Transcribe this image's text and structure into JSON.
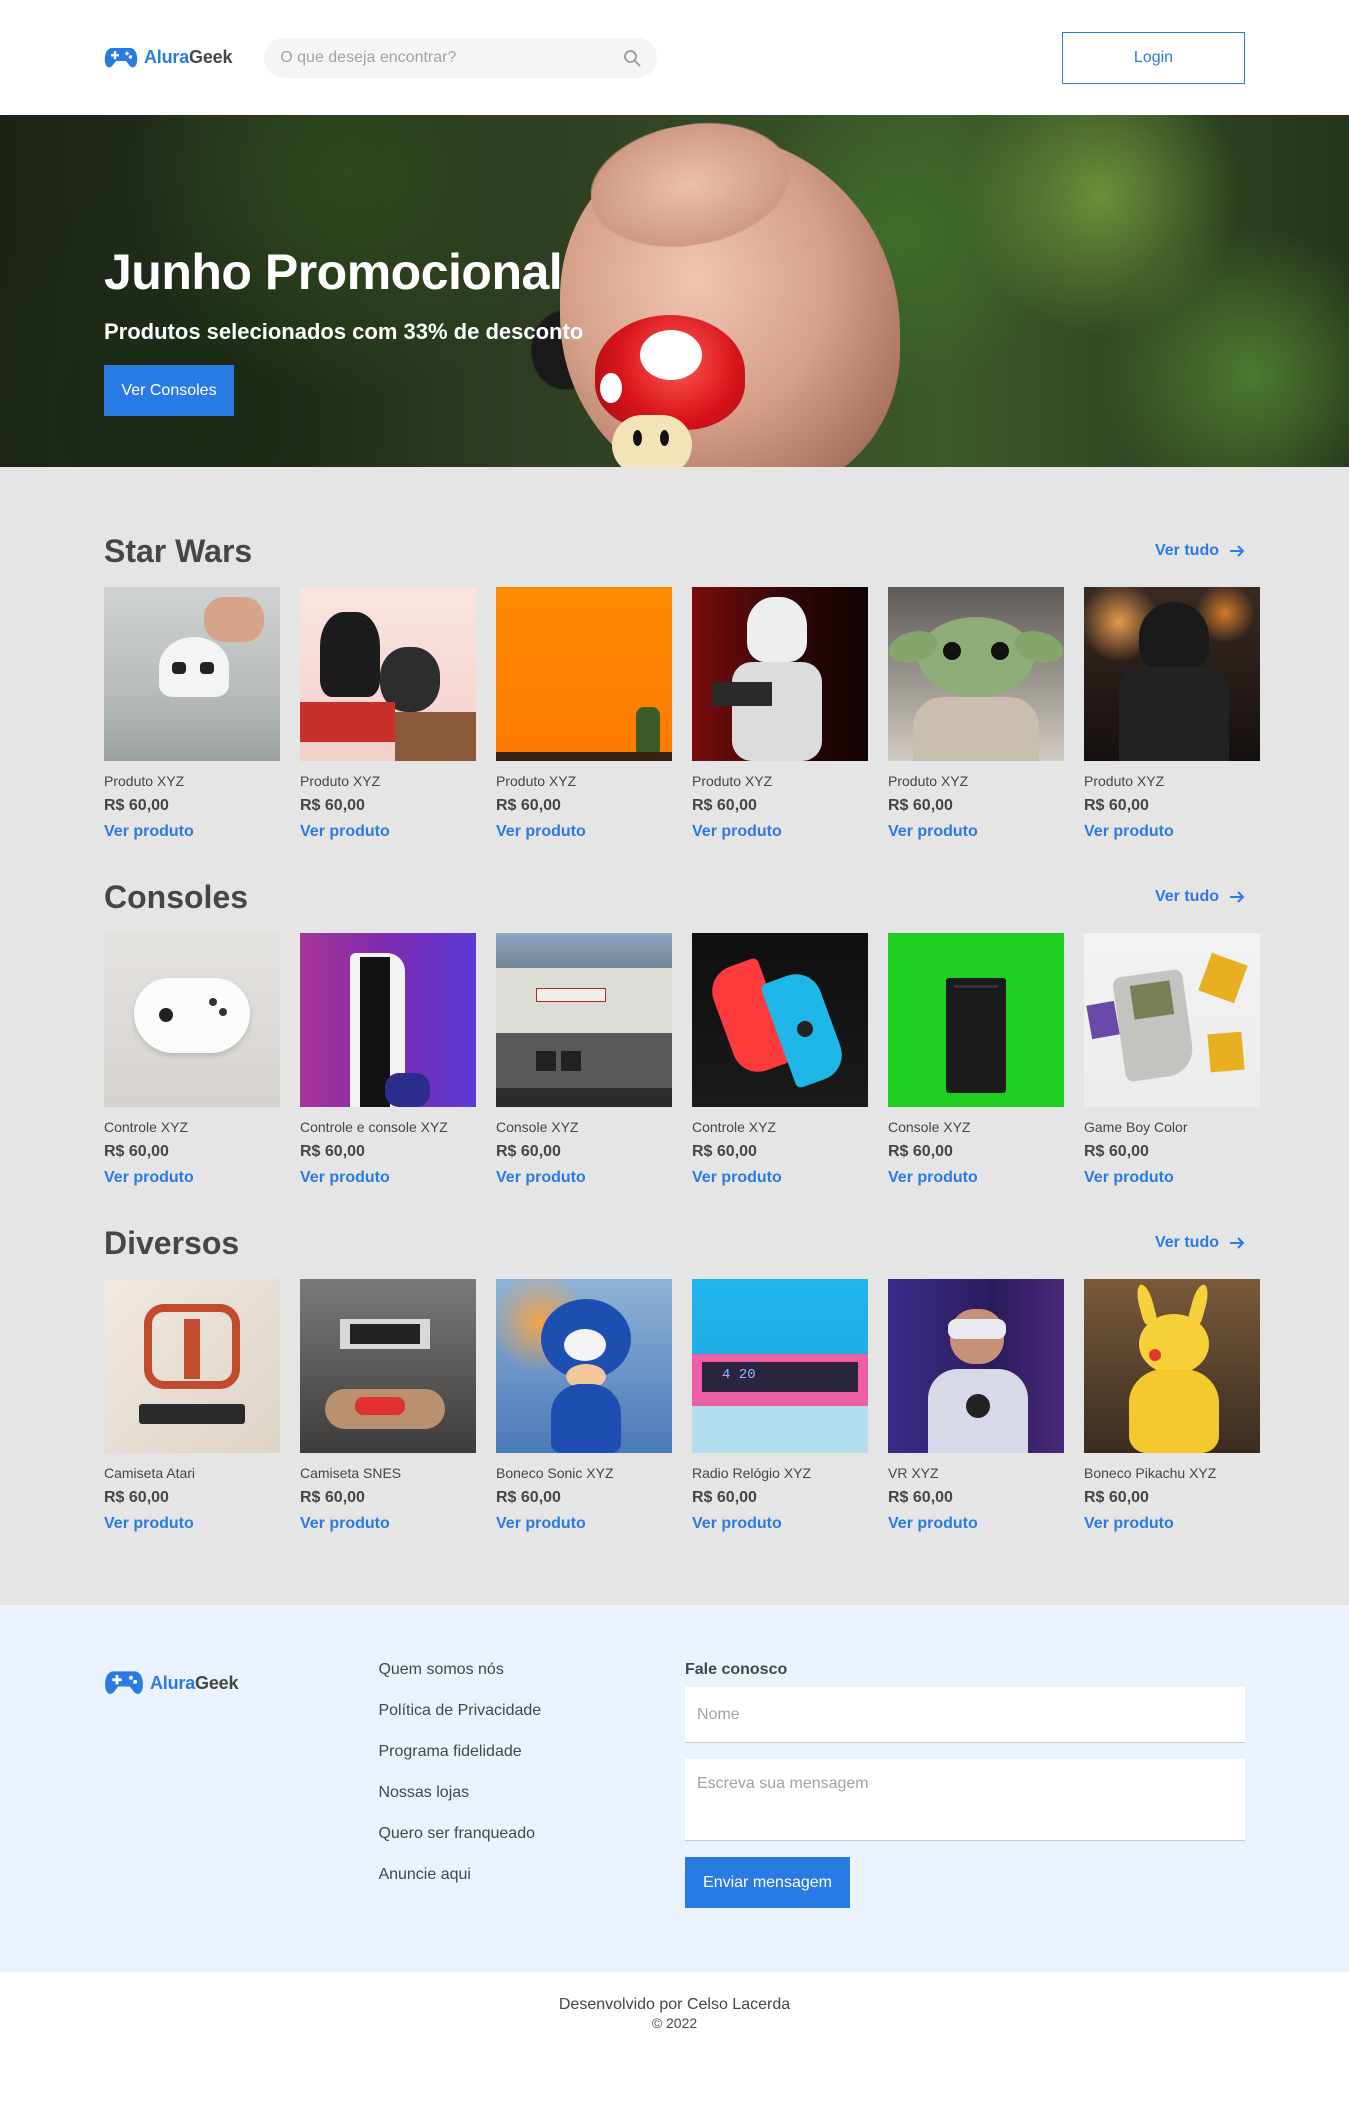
{
  "brand": {
    "name_part1": "Alura",
    "name_part2": "Geek"
  },
  "header": {
    "search_placeholder": "O que deseja encontrar?",
    "login_label": "Login"
  },
  "hero": {
    "title": "Junho Promocional",
    "subtitle": "Produtos selecionados com 33% de desconto",
    "button_label": "Ver Consoles"
  },
  "colors": {
    "accent": "#2a7ae4",
    "text": "#464646",
    "catalog_bg": "#e5e5e5",
    "footer_bg": "#eaf2fd"
  },
  "icons": {
    "logo": "gamepad-icon",
    "search": "search-icon",
    "arrow": "arrow-right-icon"
  },
  "categories": [
    {
      "title": "Star Wars",
      "link_label": "Ver tudo",
      "products": [
        {
          "name": "Produto XYZ",
          "price": "R$ 60,00",
          "link": "Ver produto"
        },
        {
          "name": "Produto XYZ",
          "price": "R$ 60,00",
          "link": "Ver produto"
        },
        {
          "name": "Produto XYZ",
          "price": "R$ 60,00",
          "link": "Ver produto"
        },
        {
          "name": "Produto XYZ",
          "price": "R$ 60,00",
          "link": "Ver produto"
        },
        {
          "name": "Produto XYZ",
          "price": "R$ 60,00",
          "link": "Ver produto"
        },
        {
          "name": "Produto XYZ",
          "price": "R$ 60,00",
          "link": "Ver produto"
        }
      ]
    },
    {
      "title": "Consoles",
      "link_label": "Ver tudo",
      "products": [
        {
          "name": "Controle XYZ",
          "price": "R$ 60,00",
          "link": "Ver produto"
        },
        {
          "name": "Controle e console XYZ",
          "price": "R$ 60,00",
          "link": "Ver produto"
        },
        {
          "name": "Console XYZ",
          "price": "R$ 60,00",
          "link": "Ver produto"
        },
        {
          "name": "Controle XYZ",
          "price": "R$ 60,00",
          "link": "Ver produto"
        },
        {
          "name": "Console XYZ",
          "price": "R$ 60,00",
          "link": "Ver produto"
        },
        {
          "name": "Game Boy Color",
          "price": "R$ 60,00",
          "link": "Ver produto"
        }
      ]
    },
    {
      "title": "Diversos",
      "link_label": "Ver tudo",
      "products": [
        {
          "name": "Camiseta Atari",
          "price": "R$ 60,00",
          "link": "Ver produto"
        },
        {
          "name": "Camiseta SNES",
          "price": "R$ 60,00",
          "link": "Ver produto"
        },
        {
          "name": "Boneco Sonic XYZ",
          "price": "R$ 60,00",
          "link": "Ver produto"
        },
        {
          "name": "Radio Relógio XYZ",
          "price": "R$ 60,00",
          "link": "Ver produto"
        },
        {
          "name": "VR XYZ",
          "price": "R$ 60,00",
          "link": "Ver produto"
        },
        {
          "name": "Boneco Pikachu XYZ",
          "price": "R$ 60,00",
          "link": "Ver produto"
        }
      ]
    }
  ],
  "footer": {
    "links": [
      "Quem somos nós",
      "Política de Privacidade",
      "Programa fidelidade",
      "Nossas lojas",
      "Quero ser franqueado",
      "Anuncie aqui"
    ],
    "form": {
      "title": "Fale conosco",
      "name_placeholder": "Nome",
      "message_placeholder": "Escreva sua mensagem",
      "button_label": "Enviar mensagem"
    }
  },
  "bottom": {
    "credit": "Desenvolvido por Celso Lacerda",
    "copyright": "© 2022"
  },
  "radio_display": "4 20"
}
